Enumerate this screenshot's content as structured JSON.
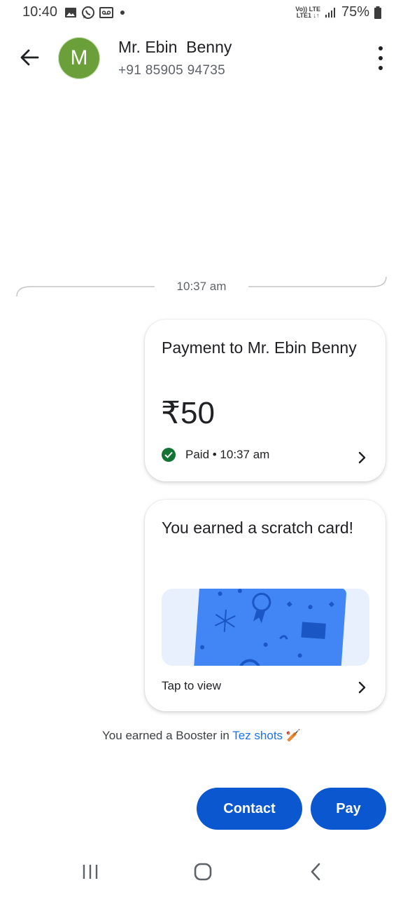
{
  "status_bar": {
    "time": "10:40",
    "network_top": "Vo)) LTE",
    "network_bottom": "LTE1 ↓↑",
    "battery": "75%"
  },
  "header": {
    "avatar_letter": "M",
    "name": "Mr. Ebin  Benny",
    "phone": "+91 85905 94735"
  },
  "chat": {
    "divider_time": "10:37 am",
    "payment_card": {
      "title": "Payment to Mr. Ebin Benny",
      "amount": "₹50",
      "status": "Paid • 10:37 am"
    },
    "scratch_card": {
      "title": "You earned a scratch card!",
      "action": "Tap to view"
    },
    "booster": {
      "prefix": "You earned a Booster in ",
      "link": "Tez shots",
      "emoji": "🏏"
    }
  },
  "actions": {
    "contact_label": "Contact",
    "pay_label": "Pay"
  },
  "colors": {
    "primary_button": "#0b57d0",
    "avatar": "#6a9f3a",
    "paid_check": "#137333",
    "scratch_card": "#4285f4",
    "link": "#1a73e8"
  },
  "icons": {
    "back": "arrow-back-icon",
    "more": "more-vert-icon",
    "paid": "check-circle-icon",
    "chevron": "chevron-right-icon",
    "nav_recent": "recent-apps-icon",
    "nav_home": "home-icon",
    "nav_back": "nav-back-icon"
  }
}
